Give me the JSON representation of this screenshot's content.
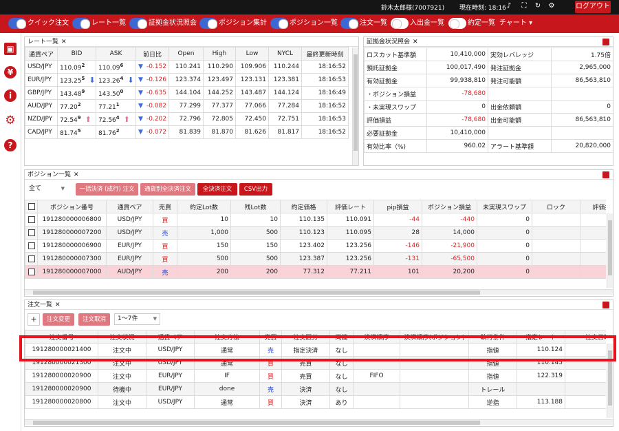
{
  "topbar": {
    "user": "鈴木太郎様(7007921)",
    "time": "現在時刻: 18:16",
    "logout": "ログアウト",
    "icons": [
      "bell-icon",
      "fullscreen-icon",
      "refresh-icon",
      "settings-icon"
    ]
  },
  "menu": {
    "toggles": [
      {
        "label": "クイック注文",
        "on": true
      },
      {
        "label": "レート一覧",
        "on": true
      },
      {
        "label": "証拠金状況照会",
        "on": true
      },
      {
        "label": "ポジション集計",
        "on": true
      },
      {
        "label": "ポジション一覧",
        "on": true
      },
      {
        "label": "注文一覧",
        "on": true
      },
      {
        "label": "入出金一覧",
        "on": false
      },
      {
        "label": "約定一覧",
        "on": false
      }
    ],
    "chart": "チャート ▾"
  },
  "sidebar": {
    "icons": [
      "save-icon",
      "yen-icon",
      "info-icon",
      "gear-icon",
      "help-icon"
    ]
  },
  "rate_panel": {
    "title": "レート一覧",
    "close": "✕",
    "headers": [
      "通貨ペア",
      "BID",
      "ASK",
      "前日比",
      "Open",
      "High",
      "Low",
      "NYCL",
      "最終更新時刻"
    ],
    "rows": [
      {
        "pair": "USD/JPY",
        "bid_a": "110.09",
        "bid_b": "2",
        "bid_arr": "",
        "ask_a": "110.09",
        "ask_b": "6",
        "ask_arr": "",
        "dir": "▼",
        "chg": "-0.152",
        "open": "110.241",
        "high": "110.290",
        "low": "109.906",
        "nycl": "110.244",
        "time": "18:16:52"
      },
      {
        "pair": "EUR/JPY",
        "bid_a": "123.25",
        "bid_b": "5",
        "bid_arr": "⬇",
        "ask_a": "123.26",
        "ask_b": "4",
        "ask_arr": "⬇",
        "dir": "▼",
        "chg": "-0.126",
        "open": "123.374",
        "high": "123.497",
        "low": "123.131",
        "nycl": "123.381",
        "time": "18:16:53"
      },
      {
        "pair": "GBP/JPY",
        "bid_a": "143.48",
        "bid_b": "9",
        "bid_arr": "",
        "ask_a": "143.50",
        "ask_b": "0",
        "ask_arr": "",
        "dir": "▼",
        "chg": "-0.635",
        "open": "144.104",
        "high": "144.252",
        "low": "143.487",
        "nycl": "144.124",
        "time": "18:16:49"
      },
      {
        "pair": "AUD/JPY",
        "bid_a": "77.20",
        "bid_b": "2",
        "bid_arr": "",
        "ask_a": "77.21",
        "ask_b": "1",
        "ask_arr": "",
        "dir": "▼",
        "chg": "-0.082",
        "open": "77.299",
        "high": "77.377",
        "low": "77.066",
        "nycl": "77.284",
        "time": "18:16:52"
      },
      {
        "pair": "NZD/JPY",
        "bid_a": "72.54",
        "bid_b": "9",
        "bid_arr": "⬆",
        "ask_a": "72.56",
        "ask_b": "4",
        "ask_arr": "⬆",
        "dir": "▼",
        "chg": "-0.202",
        "open": "72.796",
        "high": "72.805",
        "low": "72.450",
        "nycl": "72.751",
        "time": "18:16:53"
      },
      {
        "pair": "CAD/JPY",
        "bid_a": "81.74",
        "bid_b": "5",
        "bid_arr": "",
        "ask_a": "81.76",
        "ask_b": "2",
        "ask_arr": "",
        "dir": "▼",
        "chg": "-0.072",
        "open": "81.839",
        "high": "81.870",
        "low": "81.626",
        "nycl": "81.817",
        "time": "18:16:52"
      }
    ]
  },
  "margin_panel": {
    "title": "証拠金状況照会",
    "close": "✕",
    "rows": [
      {
        "k1": "ロスカット基準額",
        "v1": "10,410,000",
        "k2": "実効レバレッジ",
        "v2": "1.75倍"
      },
      {
        "k1": "預託証拠金",
        "v1": "100,017,490",
        "k2": "発注証拠金",
        "v2": "2,965,000"
      },
      {
        "k1": "有効証拠金",
        "v1": "99,938,810",
        "k2": "発注可能額",
        "v2": "86,563,810"
      },
      {
        "k1": "・ポジション損益",
        "v1": "-78,680",
        "k2": "",
        "v2": ""
      },
      {
        "k1": "・未実現スワップ",
        "v1": "0",
        "k2": "出金依頼額",
        "v2": "0"
      },
      {
        "k1": "評価損益",
        "v1": "-78,680",
        "k2": "出金可能額",
        "v2": "86,563,810"
      },
      {
        "k1": "必要証拠金",
        "v1": "10,410,000",
        "k2": "",
        "v2": ""
      },
      {
        "k1": "有効比率（%)",
        "v1": "960.02",
        "k2": "アラート基準額",
        "v2": "20,820,000"
      }
    ]
  },
  "position_panel": {
    "title": "ポジション一覧",
    "close": "✕",
    "filter": "全て",
    "buttons": [
      "一括決済 (成行) 注文",
      "通貨別全決済注文",
      "全決済注文",
      "CSV出力"
    ],
    "headers": [
      "ポジション番号",
      "通貨ペア",
      "売買",
      "約定Lot数",
      "残Lot数",
      "約定価格",
      "評価レート",
      "pip損益",
      "ポジション損益",
      "未実現スワップ",
      "ロック",
      "評価損"
    ],
    "rows": [
      {
        "id": "191280000006800",
        "pair": "USD/JPY",
        "side": "買",
        "lot": "10",
        "rem": "10",
        "price": "110.135",
        "rate": "110.091",
        "pip": "-44",
        "pl": "-440",
        "swap": "0"
      },
      {
        "id": "191280000007200",
        "pair": "USD/JPY",
        "side": "売",
        "lot": "1,000",
        "rem": "500",
        "price": "110.123",
        "rate": "110.095",
        "pip": "28",
        "pl": "14,000",
        "swap": "0"
      },
      {
        "id": "191280000006900",
        "pair": "EUR/JPY",
        "side": "買",
        "lot": "150",
        "rem": "150",
        "price": "123.402",
        "rate": "123.256",
        "pip": "-146",
        "pl": "-21,900",
        "swap": "0"
      },
      {
        "id": "191280000007300",
        "pair": "EUR/JPY",
        "side": "買",
        "lot": "500",
        "rem": "500",
        "price": "123.387",
        "rate": "123.256",
        "pip": "-131",
        "pl": "-65,500",
        "swap": "0"
      },
      {
        "id": "191280000007000",
        "pair": "AUD/JPY",
        "side": "売",
        "lot": "200",
        "rem": "200",
        "price": "77.312",
        "rate": "77.211",
        "pip": "101",
        "pl": "20,200",
        "swap": "0"
      }
    ]
  },
  "order_panel": {
    "title": "注文一覧",
    "close": "✕",
    "plus": "+",
    "btn_change": "注文変更",
    "btn_cancel": "注文取消",
    "paging": "1～7件",
    "headers": [
      "注文番号",
      "注文状況",
      "通貨ペア",
      "注文方法",
      "売買",
      "注文区分",
      "両建",
      "決済順序",
      "決済順序(ポジション)",
      "執行条件",
      "指定レート",
      "注文日時"
    ],
    "rows": [
      {
        "id": "191280000021400",
        "status": "注文中",
        "pair": "USD/JPY",
        "method": "通常",
        "side": "売",
        "kind": "指定決済",
        "both": "なし",
        "order": "",
        "cond": "指値",
        "rate": "110.124"
      },
      {
        "id": "191280000021300",
        "status": "注文中",
        "pair": "USD/JPY",
        "method": "通常",
        "side": "買",
        "kind": "売買",
        "both": "なし",
        "order": "",
        "cond": "指値",
        "rate": "110.145"
      },
      {
        "id": "191280000020900",
        "status": "注文中",
        "pair": "EUR/JPY",
        "method": "IF",
        "side": "買",
        "kind": "売買",
        "both": "なし",
        "order": "FIFO",
        "cond": "指値",
        "rate": "122.319"
      },
      {
        "id": "191280000020900",
        "status": "待機中",
        "pair": "EUR/JPY",
        "method": "done",
        "side": "売",
        "kind": "決済",
        "both": "なし",
        "order": "",
        "cond": "トレール",
        "rate": ""
      },
      {
        "id": "191280000020800",
        "status": "注文中",
        "pair": "USD/JPY",
        "method": "通常",
        "side": "買",
        "kind": "決済",
        "both": "あり",
        "order": "",
        "cond": "逆指",
        "rate": "113.188"
      }
    ]
  },
  "colors": {
    "brand_red": "#c8161d",
    "toggle_on": "#3d68d2",
    "highlight": "#e8141d",
    "row_pink": "#f9d3d8"
  }
}
